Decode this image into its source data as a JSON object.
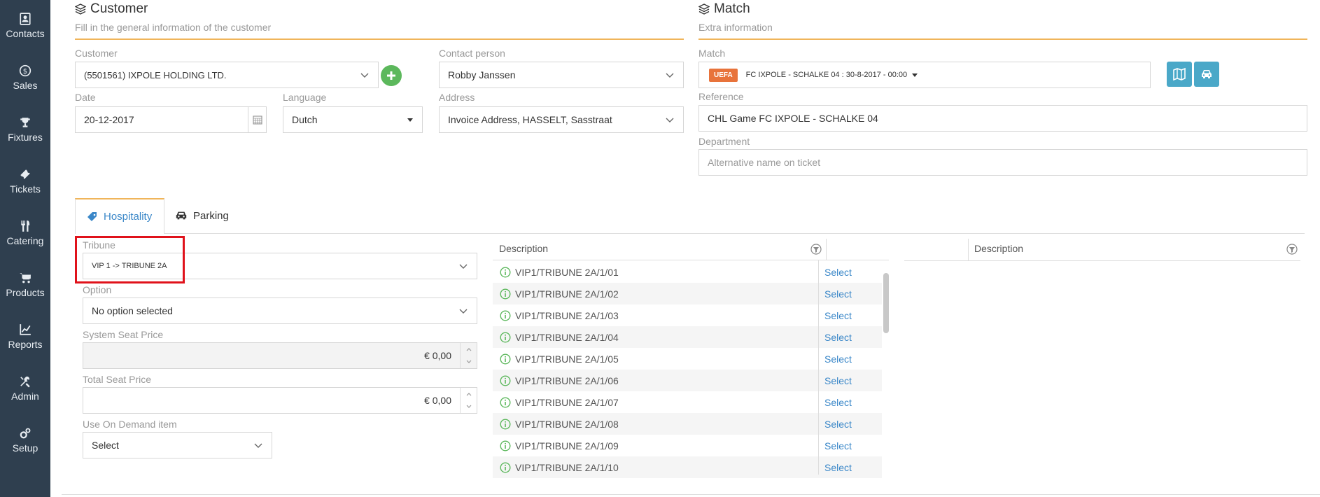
{
  "sidebar": {
    "items": [
      {
        "label": "Contacts",
        "icon": "contacts-icon"
      },
      {
        "label": "Sales",
        "icon": "sales-icon"
      },
      {
        "label": "Fixtures",
        "icon": "trophy-icon"
      },
      {
        "label": "Tickets",
        "icon": "ticket-icon"
      },
      {
        "label": "Catering",
        "icon": "cutlery-icon"
      },
      {
        "label": "Products",
        "icon": "cart-icon"
      },
      {
        "label": "Reports",
        "icon": "chart-icon"
      },
      {
        "label": "Admin",
        "icon": "tools-icon"
      },
      {
        "label": "Setup",
        "icon": "gears-icon"
      }
    ]
  },
  "customer_section": {
    "title": "Customer",
    "subtitle": "Fill in the general information of the customer",
    "customer_label": "Customer",
    "customer_value": "(5501561) IXPOLE HOLDING LTD.",
    "contact_label": "Contact person",
    "contact_value": "Robby Janssen",
    "date_label": "Date",
    "date_value": "20-12-2017",
    "language_label": "Language",
    "language_value": "Dutch",
    "address_label": "Address",
    "address_value": "Invoice Address, HASSELT, Sasstraat"
  },
  "match_section": {
    "title": "Match",
    "subtitle": "Extra information",
    "match_label": "Match",
    "match_badge": "UEFA",
    "match_value": "FC IXPOLE - SCHALKE 04 : 30-8-2017 - 00:00",
    "reference_label": "Reference",
    "reference_value": "CHL Game FC IXPOLE - SCHALKE 04",
    "department_label": "Department",
    "department_placeholder": "Alternative name on ticket"
  },
  "tabs": [
    {
      "label": "Hospitality",
      "icon": "tag-icon",
      "active": true
    },
    {
      "label": "Parking",
      "icon": "car-icon",
      "active": false
    }
  ],
  "hospitality": {
    "tribune_label": "Tribune",
    "tribune_value": "VIP 1 -> TRIBUNE 2A",
    "option_label": "Option",
    "option_value": "No option selected",
    "system_price_label": "System Seat Price",
    "system_price_value": "€ 0,00",
    "total_price_label": "Total Seat Price",
    "total_price_value": "€ 0,00",
    "on_demand_label": "Use On Demand item",
    "on_demand_value": "Select"
  },
  "seats_table": {
    "header": "Description",
    "select_label": "Select",
    "rows": [
      "VIP1/TRIBUNE 2A/1/01",
      "VIP1/TRIBUNE 2A/1/02",
      "VIP1/TRIBUNE 2A/1/03",
      "VIP1/TRIBUNE 2A/1/04",
      "VIP1/TRIBUNE 2A/1/05",
      "VIP1/TRIBUNE 2A/1/06",
      "VIP1/TRIBUNE 2A/1/07",
      "VIP1/TRIBUNE 2A/1/08",
      "VIP1/TRIBUNE 2A/1/09",
      "VIP1/TRIBUNE 2A/1/10"
    ]
  },
  "selected_table": {
    "header": "Description"
  },
  "colors": {
    "sidebar": "#2f3f4f",
    "accent": "#f0b55a",
    "link": "#3a87c8",
    "highlight": "#e0121b"
  }
}
